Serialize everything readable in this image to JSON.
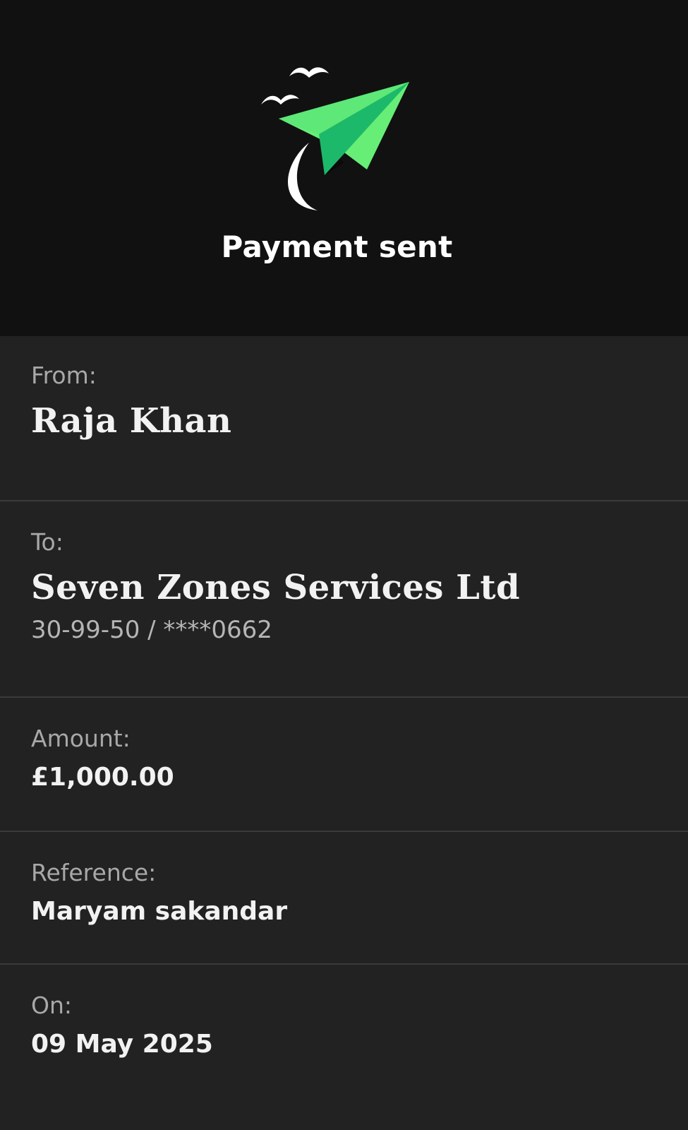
{
  "header": {
    "title": "Payment sent",
    "icon": "paper-plane-icon",
    "colors": {
      "plane_light": "#66EE77",
      "plane_dark": "#1DB96A",
      "background": "#111111"
    }
  },
  "details": {
    "from": {
      "label": "From:",
      "value": "Raja Khan"
    },
    "to": {
      "label": "To:",
      "value": "Seven Zones Services Ltd",
      "account": "30-99-50 / ****0662"
    },
    "amount": {
      "label": "Amount:",
      "value": "£1,000.00"
    },
    "reference": {
      "label": "Reference:",
      "value": "Maryam sakandar"
    },
    "on": {
      "label": "On:",
      "value": "09 May 2025"
    }
  }
}
